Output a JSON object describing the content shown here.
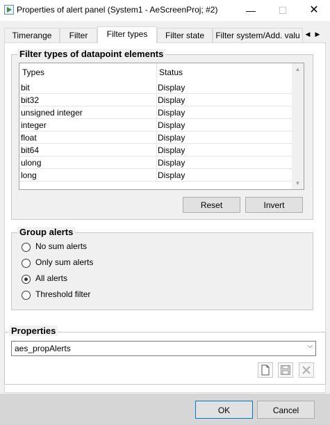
{
  "window": {
    "title": "Properties of alert panel (System1 - AeScreenProj; #2)",
    "minimize_glyph": "—",
    "maximize_glyph": "☐",
    "close_glyph": "✕"
  },
  "tabs": [
    {
      "label": "Timerange",
      "active": false
    },
    {
      "label": "Filter",
      "active": false
    },
    {
      "label": "Filter types",
      "active": true
    },
    {
      "label": "Filter state",
      "active": false
    },
    {
      "label": "Filter system/Add. valu",
      "active": false
    }
  ],
  "tab_scroll": {
    "left": "◀",
    "right": "▶"
  },
  "filter_types": {
    "group_title": "Filter types of datapoint elements",
    "columns": [
      "Types",
      "Status"
    ],
    "rows": [
      {
        "type": "bit",
        "status": "Display"
      },
      {
        "type": "bit32",
        "status": "Display"
      },
      {
        "type": "unsigned integer",
        "status": "Display"
      },
      {
        "type": "integer",
        "status": "Display"
      },
      {
        "type": "float",
        "status": "Display"
      },
      {
        "type": "bit64",
        "status": "Display"
      },
      {
        "type": "ulong",
        "status": "Display"
      },
      {
        "type": "long",
        "status": "Display"
      }
    ],
    "reset_label": "Reset",
    "invert_label": "Invert"
  },
  "group_alerts": {
    "title": "Group alerts",
    "options": [
      {
        "label": "No sum alerts",
        "selected": false
      },
      {
        "label": "Only sum alerts",
        "selected": false
      },
      {
        "label": "All alerts",
        "selected": true
      },
      {
        "label": "Threshold filter",
        "selected": false
      }
    ]
  },
  "properties": {
    "title": "Properties",
    "selected_value": "aes_propAlerts",
    "icons": [
      "new-file-icon",
      "save-icon",
      "delete-icon"
    ]
  },
  "footer": {
    "ok_label": "OK",
    "cancel_label": "Cancel"
  }
}
